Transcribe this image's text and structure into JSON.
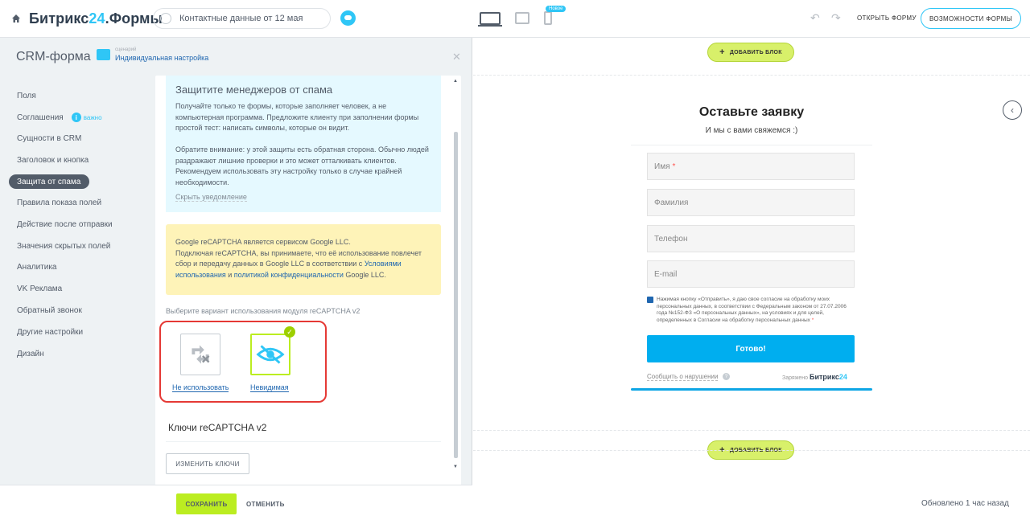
{
  "topbar": {
    "logo_main": "Битрикс",
    "logo_num": "24",
    "logo_suffix": ".Формы",
    "form_title": "Контактные данные от 12 мая",
    "badge_new": "Новое",
    "open_form": "ОТКРЫТЬ ФОРМУ",
    "features": "ВОЗМОЖНОСТИ ФОРМЫ"
  },
  "panel": {
    "title": "CRM-форма",
    "scenario_label": "сценарий",
    "scenario_value": "Индивидуальная настройка",
    "nav": [
      {
        "label": "Поля"
      },
      {
        "label": "Соглашения",
        "badge": "важно"
      },
      {
        "label": "Сущности в CRM"
      },
      {
        "label": "Заголовок и кнопка"
      },
      {
        "label": "Защита от спама",
        "active": true
      },
      {
        "label": "Правила показа полей"
      },
      {
        "label": "Действие после отправки"
      },
      {
        "label": "Значения скрытых полей"
      },
      {
        "label": "Аналитика"
      },
      {
        "label": "VK Реклама"
      },
      {
        "label": "Обратный звонок"
      },
      {
        "label": "Другие настройки"
      },
      {
        "label": "Дизайн"
      }
    ],
    "notice": {
      "title": "Защитите менеджеров от спама",
      "text1": "Получайте только те формы, которые заполняет человек, а не компьютерная программа. Предложите клиенту при заполнении формы простой тест: написать символы, которые он видит.",
      "text2": "Обратите внимание: у этой защиты есть обратная сторона. Обычно людей раздражают лишние проверки и это может отталкивать клиентов. Рекомендуем использовать эту настройку только в случае крайней необходимости.",
      "hide": "Скрыть уведомление"
    },
    "google": {
      "line1": "Google reCAPTCHA является сервисом Google LLC.",
      "line2a": "Подключая reCAPTCHA, вы принимаете, что её использование повлечет сбор и передачу данных в Google LLC в соответствии с ",
      "link1": "Условиями использования",
      "and": " и ",
      "link2": "политикой конфиденциальности",
      "tail": " Google LLC."
    },
    "choose_label": "Выберите вариант использования модуля reCAPTCHA v2",
    "options": [
      {
        "label": "Не использовать",
        "icon": "no-captcha-icon"
      },
      {
        "label": "Невидимая",
        "icon": "eye-off-icon",
        "selected": true
      }
    ],
    "keys_title": "Ключи reCAPTCHA v2",
    "change_keys": "ИЗМЕНИТЬ КЛЮЧИ",
    "save": "СОХРАНИТЬ",
    "cancel": "ОТМЕНИТЬ"
  },
  "preview": {
    "add_block": "ДОБАВИТЬ БЛОК",
    "form_title": "Оставьте заявку",
    "form_sub": "И мы с вами свяжемся :)",
    "fields": [
      {
        "placeholder": "Имя",
        "required": true
      },
      {
        "placeholder": "Фамилия",
        "required": false
      },
      {
        "placeholder": "Телефон",
        "required": false
      },
      {
        "placeholder": "E-mail",
        "required": false
      }
    ],
    "consent": "Нажимая кнопку «Отправить», я даю свое согласие на обработку моих персональных данных, в соответствии с Федеральным законом от 27.07.2006 года №152-ФЗ «О персональных данных», на условиях и для целей, определенных в Согласии на обработку персональных данных",
    "submit": "Готово!",
    "report": "Сообщить о нарушении",
    "charged": "Заряжено",
    "b24_main": "Битрикс",
    "b24_num": "24",
    "updated": "Обновлено 1 час назад"
  },
  "colors": {
    "accent": "#2fc6f6",
    "save_green": "#bbed21",
    "submit_blue": "#00aeef",
    "highlight_red": "#e53935"
  }
}
